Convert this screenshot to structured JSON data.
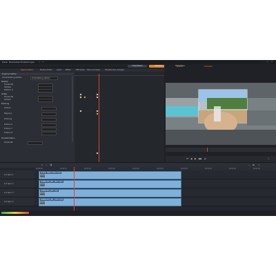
{
  "menu": {
    "items": [
      "Datei",
      "Bearbeiten",
      "Einstellungen"
    ]
  },
  "modes": [
    {
      "label": "Importieren",
      "active": false
    },
    {
      "label": "Editieren",
      "active": true
    },
    {
      "label": "Exportieren",
      "active": false
    }
  ],
  "tabs": [
    "Eigenschaften",
    "Medien-Editor",
    "Audio",
    "Effekt",
    "NFP-Video",
    "Titel und Texte",
    "Titel-Blocken-Anzeige"
  ],
  "panel": {
    "title": "Eigenschaften",
    "preset_label": "Voreinstellung wählen",
    "preset_value": "Voreinstellung wählen",
    "sections": [
      {
        "label": "Position",
        "rows": [
          "Horizontal",
          "Vertikal",
          "Position Z"
        ]
      },
      {
        "label": "Größe",
        "rows": [
          "Horizontal",
          "Vertikal"
        ]
      },
      {
        "label": "Drehung",
        "rows": [
          "Drehen",
          "Neigung",
          "Drehung",
          "Drehen X",
          "Drehen Y",
          "Drehen Z"
        ]
      },
      {
        "label": "Transformation",
        "rows": [
          "Deckkraft"
        ]
      }
    ]
  },
  "preview": {
    "title": "Vorschau",
    "tabs": [
      "Quelle",
      "Timeline"
    ]
  },
  "timeline": {
    "tracks": [
      {
        "label": "1/1 Spur 1",
        "clips": [
          {
            "title": "Ordner Datei Video.mp4"
          }
        ]
      },
      {
        "label": "1/1 Spur 2",
        "clips": [
          {
            "title": "GOPR1234_001_Hero.mp4"
          }
        ]
      },
      {
        "label": "1/1 Spur 3",
        "clips": [
          {
            "title": "GOPR2345_001.mp4"
          }
        ]
      },
      {
        "label": "1/1 Spur 4",
        "clips": [
          {
            "title": "GOPR1234_001_1001.mp4"
          }
        ]
      }
    ],
    "ticks": [
      "00:00:00",
      "00:00:10",
      "00:00:20",
      "00:00:30",
      "00:00:40",
      "00:00:50",
      "00:01:00",
      "00:01:10",
      "00:01:20",
      "00:01:30"
    ]
  },
  "colors": {
    "accent": "#e8852a",
    "clip": "#7fb0d9",
    "playhead": "#d9452e"
  }
}
